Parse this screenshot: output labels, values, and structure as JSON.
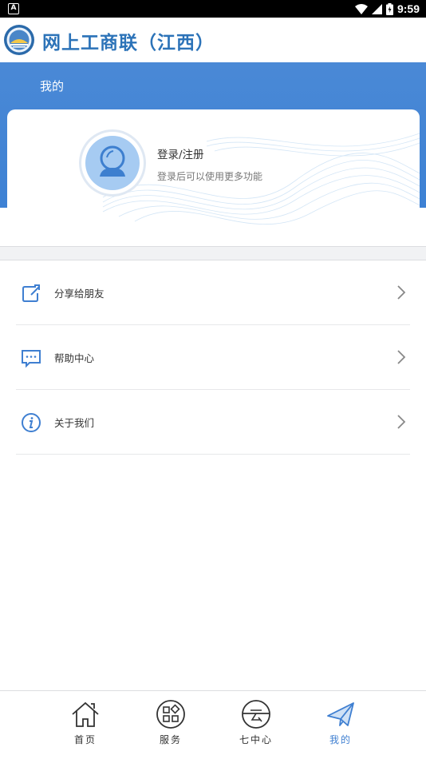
{
  "status_bar": {
    "notification_badge": "A",
    "time": "9:59"
  },
  "header": {
    "app_title": "网上工商联（江西）"
  },
  "page": {
    "title": "我的"
  },
  "profile": {
    "login_label": "登录/注册",
    "login_hint": "登录后可以使用更多功能"
  },
  "menu": {
    "items": [
      {
        "label": "分享给朋友",
        "icon": "share-icon"
      },
      {
        "label": "帮助中心",
        "icon": "message-icon"
      },
      {
        "label": "关于我们",
        "icon": "info-icon"
      }
    ]
  },
  "tabbar": {
    "tabs": [
      {
        "label": "首页",
        "icon": "home-icon"
      },
      {
        "label": "服务",
        "icon": "services-icon"
      },
      {
        "label": "七中心",
        "icon": "center-icon"
      },
      {
        "label": "我的",
        "icon": "paper-plane-icon"
      }
    ],
    "active_index": 3
  },
  "colors": {
    "accent": "#3f7fd1",
    "header_blue": "#4a89d6",
    "title_blue": "#2c73b8",
    "avatar": "#a6cbf2"
  }
}
